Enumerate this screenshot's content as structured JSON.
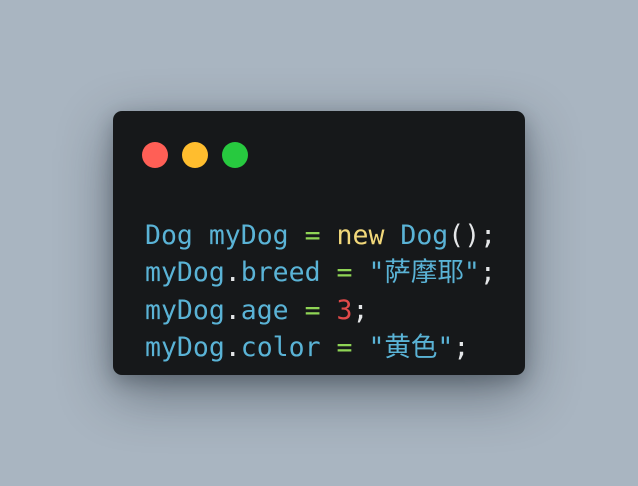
{
  "window": {
    "controls": [
      "close",
      "minimize",
      "zoom"
    ],
    "colors": {
      "background": "#16181a",
      "close": "#ff5f56",
      "minimize": "#ffbd2e",
      "zoom": "#27c93f"
    }
  },
  "code": {
    "language": "java",
    "lines": [
      [
        {
          "text": "Dog",
          "type": "ident"
        },
        {
          "text": " ",
          "type": "plain"
        },
        {
          "text": "myDog",
          "type": "ident"
        },
        {
          "text": " ",
          "type": "plain"
        },
        {
          "text": "=",
          "type": "op"
        },
        {
          "text": " ",
          "type": "plain"
        },
        {
          "text": "new",
          "type": "kw"
        },
        {
          "text": " ",
          "type": "plain"
        },
        {
          "text": "Dog",
          "type": "ident"
        },
        {
          "text": "();",
          "type": "plain"
        }
      ],
      [
        {
          "text": "myDog",
          "type": "ident"
        },
        {
          "text": ".",
          "type": "plain"
        },
        {
          "text": "breed",
          "type": "ident"
        },
        {
          "text": " ",
          "type": "plain"
        },
        {
          "text": "=",
          "type": "op"
        },
        {
          "text": " ",
          "type": "plain"
        },
        {
          "text": "\"萨摩耶\"",
          "type": "str"
        },
        {
          "text": ";",
          "type": "plain"
        }
      ],
      [
        {
          "text": "myDog",
          "type": "ident"
        },
        {
          "text": ".",
          "type": "plain"
        },
        {
          "text": "age",
          "type": "ident"
        },
        {
          "text": " ",
          "type": "plain"
        },
        {
          "text": "=",
          "type": "op"
        },
        {
          "text": " ",
          "type": "plain"
        },
        {
          "text": "3",
          "type": "num"
        },
        {
          "text": ";",
          "type": "plain"
        }
      ],
      [
        {
          "text": "myDog",
          "type": "ident"
        },
        {
          "text": ".",
          "type": "plain"
        },
        {
          "text": "color",
          "type": "ident"
        },
        {
          "text": " ",
          "type": "plain"
        },
        {
          "text": "=",
          "type": "op"
        },
        {
          "text": " ",
          "type": "plain"
        },
        {
          "text": "\"黄色\"",
          "type": "str"
        },
        {
          "text": ";",
          "type": "plain"
        }
      ]
    ]
  }
}
